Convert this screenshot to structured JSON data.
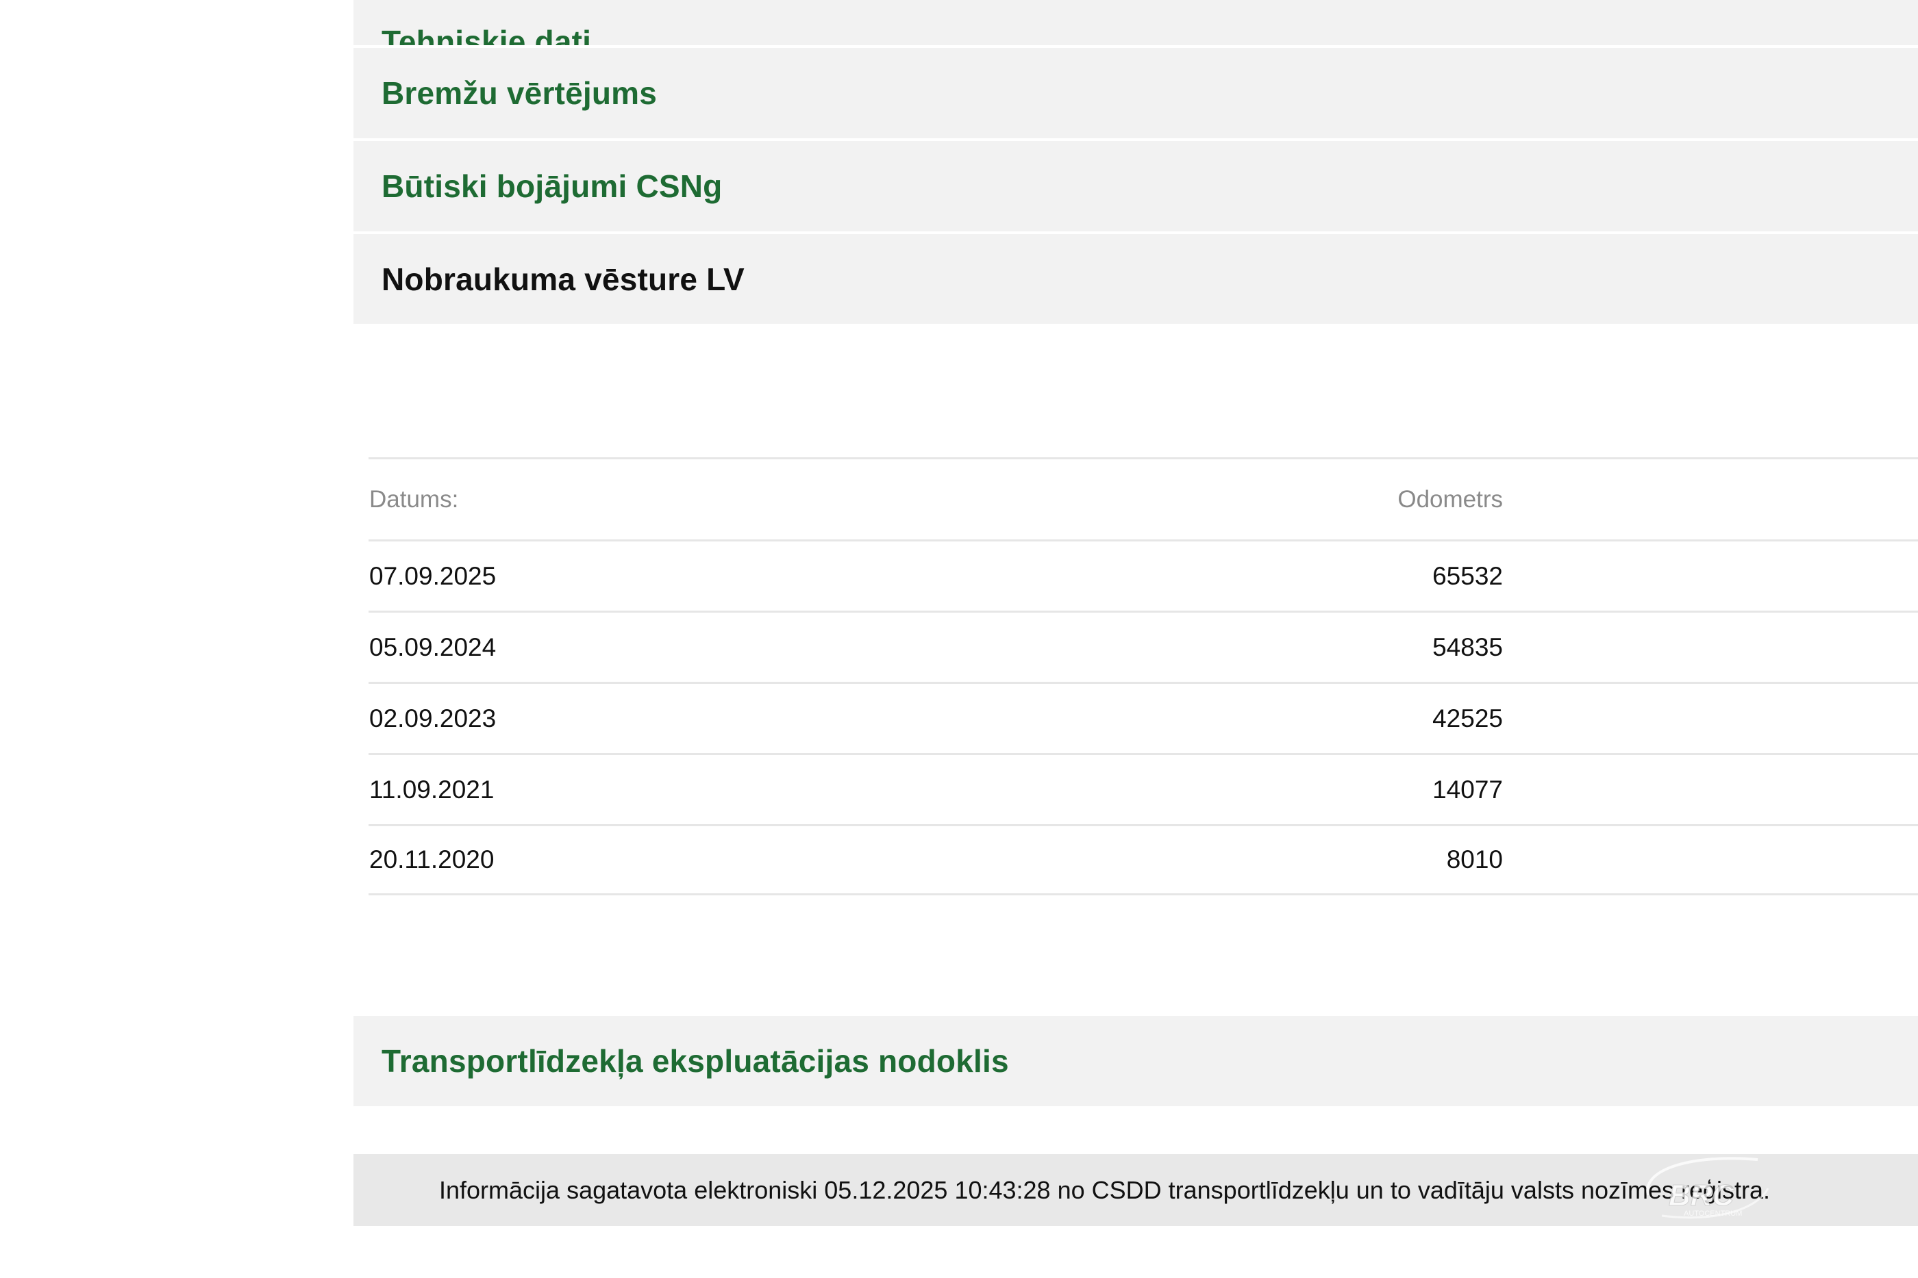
{
  "sections": {
    "tehniskie_dati": "Tehniskie dati",
    "bremzu_vertejums": "Bremžu vērtējums",
    "butiski_bojajumi": "Būtiski bojājumi CSNg",
    "nobraukuma_vesture": "Nobraukuma vēsture LV",
    "ekspluatacijas_nodoklis": "Transportlīdzekļa ekspluatācijas nodoklis"
  },
  "mileage_table": {
    "headers": {
      "date": "Datums:",
      "odometer": "Odometrs"
    },
    "rows": [
      {
        "date": "07.09.2025",
        "odometer": "65532"
      },
      {
        "date": "05.09.2024",
        "odometer": "54835"
      },
      {
        "date": "02.09.2023",
        "odometer": "42525"
      },
      {
        "date": "11.09.2021",
        "odometer": "14077"
      },
      {
        "date": "20.11.2020",
        "odometer": "8010"
      }
    ]
  },
  "footer": {
    "info_text": "Informācija sagatavota elektroniski 05.12.2025 10:43:28 no CSDD transportlīdzekļu un to vadītāju valsts nozīmes reģistra."
  },
  "watermark": {
    "brand": "BRC",
    "subtext": "AUTOCENTRUM",
    "color": "#ffffff"
  }
}
